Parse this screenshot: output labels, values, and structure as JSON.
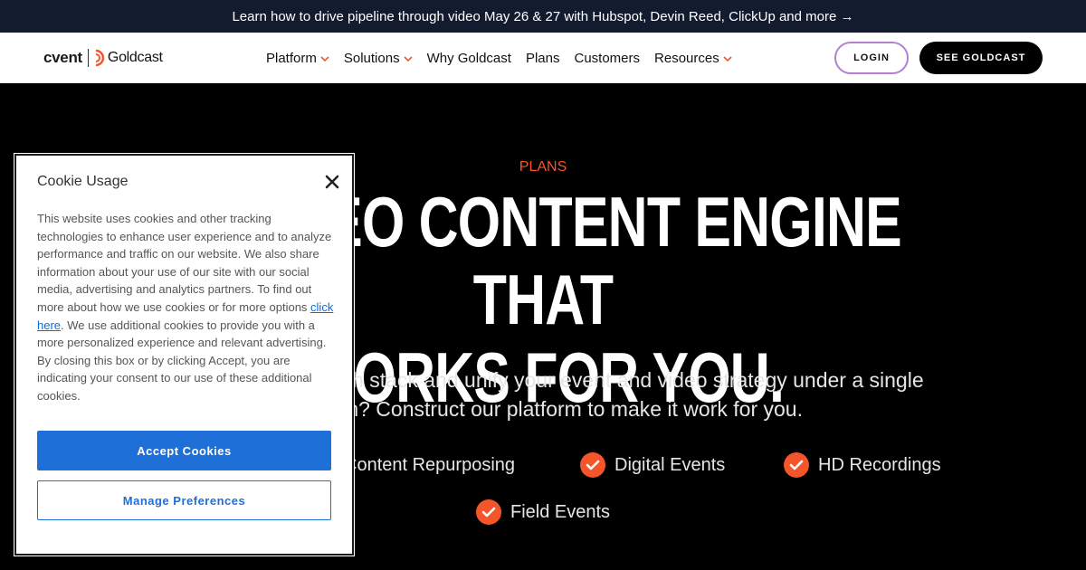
{
  "announcement": {
    "text": "Learn how to drive pipeline through video May 26 & 27 with Hubspot, Devin Reed, ClickUp and more →"
  },
  "logo": {
    "brand_a": "cvent",
    "brand_b": "Goldcast"
  },
  "nav": {
    "items": [
      {
        "label": "Platform",
        "dropdown": true
      },
      {
        "label": "Solutions",
        "dropdown": true
      },
      {
        "label": "Why Goldcast",
        "dropdown": false
      },
      {
        "label": "Plans",
        "dropdown": false
      },
      {
        "label": "Customers",
        "dropdown": false
      },
      {
        "label": "Resources",
        "dropdown": true
      }
    ],
    "login_label": "LOGIN",
    "cta_label": "SEE GOLDCAST"
  },
  "hero": {
    "eyebrow": "PLANS",
    "headline_line1": "A VIDEO CONTENT ENGINE THAT",
    "headline_line2": "WORKS FOR YOU.",
    "subtitle_line1": "Consolidate your tech stack and unify your event and video strategy under a single",
    "subtitle_line2": "platform? Construct our platform to make it work for you.",
    "features": [
      "Content Repurposing",
      "Digital Events",
      "HD Recordings",
      "Field Events"
    ]
  },
  "cookie": {
    "title": "Cookie Usage",
    "body_before_link": "This website uses cookies and other tracking technologies to enhance user experience and to analyze performance and traffic on our website. We also share information about your use of our site with our social media, advertising and analytics partners. To find out more about how we use cookies or for more options ",
    "link_text": "click here",
    "body_after_link": ". We use additional cookies to provide you with a more personalized experience and relevant advertising. By closing this box or by clicking Accept, you are indicating your consent to our use of these additional cookies.",
    "accept_label": "Accept Cookies",
    "manage_label": "Manage Preferences"
  },
  "colors": {
    "accent": "#f4552a",
    "cookie_button": "#1f6fd8",
    "announce_bg": "#131b2e",
    "login_border": "#b47fd3"
  }
}
